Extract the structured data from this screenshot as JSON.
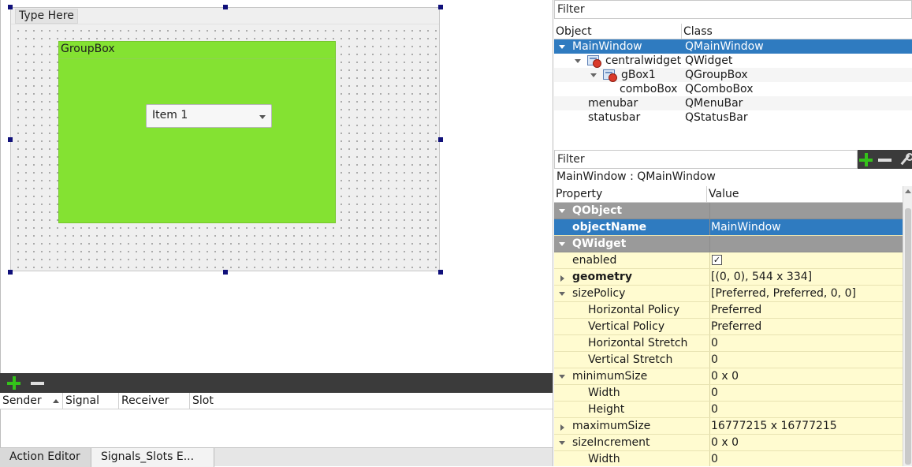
{
  "form": {
    "menu_placeholder": "Type Here",
    "groupbox_title": "GroupBox",
    "combo_value": "Item 1"
  },
  "signals_slots": {
    "columns": [
      "Sender",
      "Signal",
      "Receiver",
      "Slot"
    ]
  },
  "tabs": [
    "Action Editor",
    "Signals_Slots E..."
  ],
  "object_inspector": {
    "filter_placeholder": "Filter",
    "columns": [
      "Object",
      "Class"
    ],
    "rows": [
      {
        "object": "MainWindow",
        "class": "QMainWindow"
      },
      {
        "object": "centralwidget",
        "class": "QWidget"
      },
      {
        "object": "gBox1",
        "class": "QGroupBox"
      },
      {
        "object": "comboBox",
        "class": "QComboBox"
      },
      {
        "object": "menubar",
        "class": "QMenuBar"
      },
      {
        "object": "statusbar",
        "class": "QStatusBar"
      }
    ]
  },
  "property_editor": {
    "filter_placeholder": "Filter",
    "class_label": "MainWindow : QMainWindow",
    "columns": [
      "Property",
      "Value"
    ],
    "rows": [
      {
        "name": "QObject",
        "value": ""
      },
      {
        "name": "objectName",
        "value": "MainWindow"
      },
      {
        "name": "QWidget",
        "value": ""
      },
      {
        "name": "enabled",
        "value": "✓"
      },
      {
        "name": "geometry",
        "value": "[(0, 0), 544 x 334]"
      },
      {
        "name": "sizePolicy",
        "value": "[Preferred, Preferred, 0, 0]"
      },
      {
        "name": "Horizontal Policy",
        "value": "Preferred"
      },
      {
        "name": "Vertical Policy",
        "value": "Preferred"
      },
      {
        "name": "Horizontal Stretch",
        "value": "0"
      },
      {
        "name": "Vertical Stretch",
        "value": "0"
      },
      {
        "name": "minimumSize",
        "value": "0 x 0"
      },
      {
        "name": "Width",
        "value": "0"
      },
      {
        "name": "Height",
        "value": "0"
      },
      {
        "name": "maximumSize",
        "value": "16777215 x 16777215"
      },
      {
        "name": "sizeIncrement",
        "value": "0 x 0"
      },
      {
        "name": "Width",
        "value": "0"
      }
    ]
  },
  "colors": {
    "groupbox_bg": "#84e232",
    "selection": "#2f7bc0",
    "property_bg": "#fffbd0",
    "group_header": "#9a9a9a"
  }
}
